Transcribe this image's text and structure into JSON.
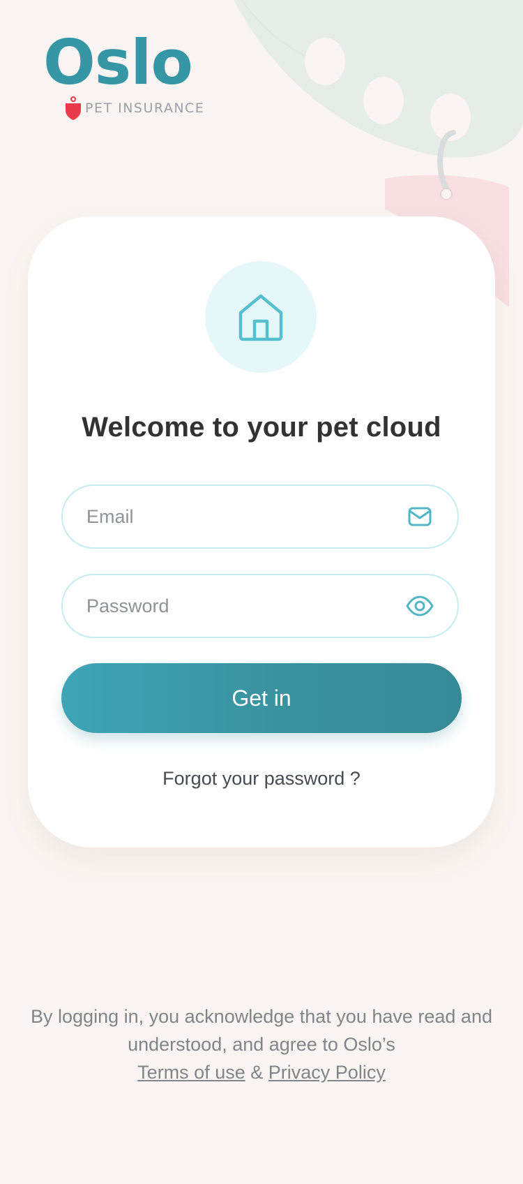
{
  "brand": {
    "wordmark": "Oslo",
    "tagline": "PET INSURANCE"
  },
  "card": {
    "icon": "home-icon",
    "title": "Welcome to your pet cloud"
  },
  "form": {
    "email": {
      "value": "",
      "placeholder": "Email",
      "icon": "mail-icon"
    },
    "password": {
      "value": "",
      "placeholder": "Password",
      "icon": "eye-icon"
    },
    "submit_label": "Get in",
    "forgot_label": "Forgot your password ?"
  },
  "legal": {
    "line1": "By logging in, you acknowledge that you have read and understood, and agree to Oslo’s",
    "terms_label": "Terms of use",
    "separator": "&",
    "privacy_label": "Privacy Policy"
  },
  "colors": {
    "background": "#faf5f2",
    "accent": "#3a9aa8",
    "badge": "#e8394d",
    "field_border": "#c5ecf1",
    "icon_circle": "#e6f7f9"
  }
}
